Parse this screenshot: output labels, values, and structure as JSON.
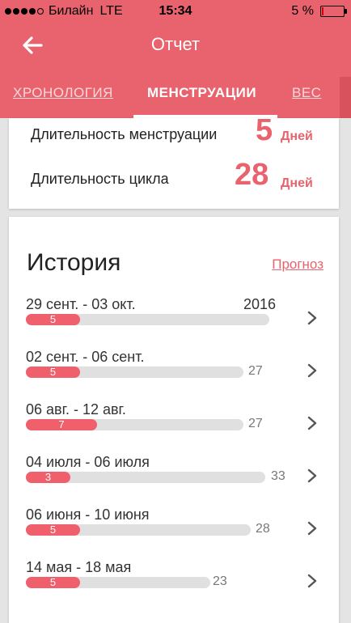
{
  "status_bar": {
    "carrier": "Билайн",
    "network": "LTE",
    "time": "15:34",
    "battery": "5 %"
  },
  "header": {
    "title": "Отчет",
    "back_icon": "arrow-left-icon"
  },
  "tabs": [
    {
      "label": "ХРОНОЛОГИЯ",
      "active": false
    },
    {
      "label": "МЕНСТРУАЦИИ",
      "active": true
    },
    {
      "label": "ВЕС",
      "active": false
    }
  ],
  "summary": {
    "period_label": "Длительность менструации",
    "period_value": "5",
    "period_unit": "Дней",
    "cycle_label": "Длительность цикла",
    "cycle_value": "28",
    "cycle_unit": "Дней"
  },
  "history": {
    "title": "История",
    "forecast_link": "Прогноз",
    "rows": [
      {
        "dates": "29 сент. - 03 окт.",
        "year": "2016",
        "period": "5",
        "cycle": ""
      },
      {
        "dates": "02 сент. - 06 сент.",
        "year": "",
        "period": "5",
        "cycle": "27"
      },
      {
        "dates": "06 авг. - 12 авг.",
        "year": "",
        "period": "7",
        "cycle": "27"
      },
      {
        "dates": "04 июля - 06 июля",
        "year": "",
        "period": "3",
        "cycle": "33"
      },
      {
        "dates": "06 июня - 10 июня",
        "year": "",
        "period": "5",
        "cycle": "28"
      },
      {
        "dates": "14 мая - 18 мая",
        "year": "",
        "period": "5",
        "cycle": "23"
      }
    ]
  },
  "colors": {
    "accent": "#e8636d",
    "bar": "#f0606c",
    "track": "#e0e0e0"
  }
}
